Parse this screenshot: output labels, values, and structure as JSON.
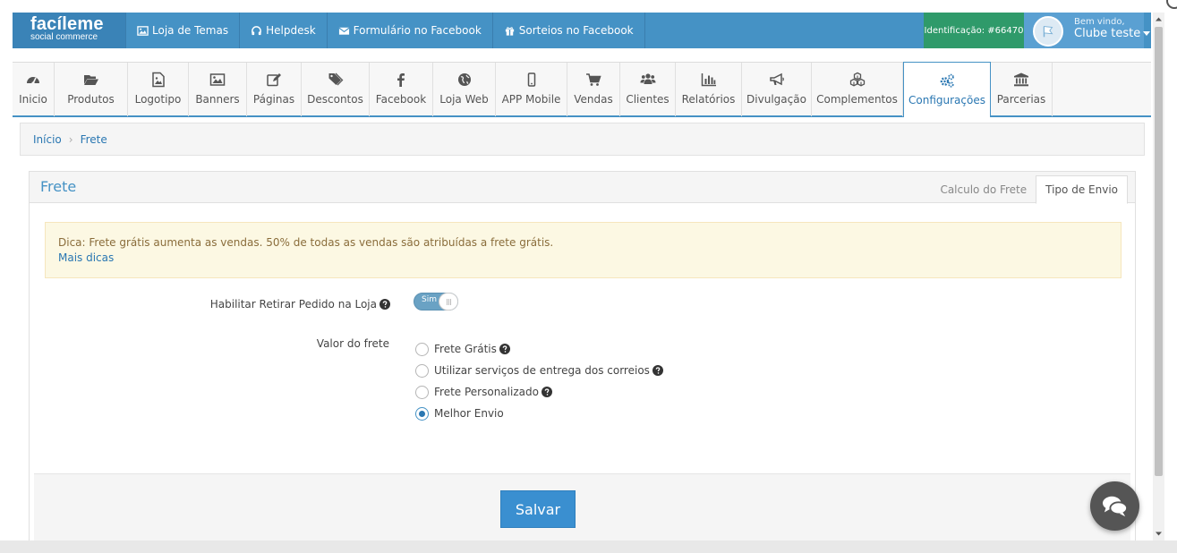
{
  "brand": {
    "name": "facíleme",
    "tagline": "social commerce"
  },
  "toplinks": [
    {
      "label": "Loja de Temas",
      "icon": "image-icon"
    },
    {
      "label": "Helpdesk",
      "icon": "headphones-icon"
    },
    {
      "label": "Formulário no Facebook",
      "icon": "envelope-icon"
    },
    {
      "label": "Sorteios no Facebook",
      "icon": "gift-icon"
    }
  ],
  "identification": "Identificação: #66470",
  "user": {
    "welcome": "Bem vindo,",
    "name": "Clube teste"
  },
  "nav": [
    {
      "label": "Inicio",
      "icon": "dashboard-icon"
    },
    {
      "label": "Produtos",
      "icon": "folder-open-icon"
    },
    {
      "label": "Logotipo",
      "icon": "file-image-icon"
    },
    {
      "label": "Banners",
      "icon": "picture-icon"
    },
    {
      "label": "Páginas",
      "icon": "edit-icon"
    },
    {
      "label": "Descontos",
      "icon": "tags-icon"
    },
    {
      "label": "Facebook",
      "icon": "facebook-icon"
    },
    {
      "label": "Loja Web",
      "icon": "globe-icon"
    },
    {
      "label": "APP Mobile",
      "icon": "mobile-icon"
    },
    {
      "label": "Vendas",
      "icon": "cart-icon"
    },
    {
      "label": "Clientes",
      "icon": "users-icon"
    },
    {
      "label": "Relatórios",
      "icon": "bar-chart-icon"
    },
    {
      "label": "Divulgação",
      "icon": "bullhorn-icon"
    },
    {
      "label": "Complementos",
      "icon": "cubes-icon"
    },
    {
      "label": "Configurações",
      "icon": "cogs-icon",
      "active": true
    },
    {
      "label": "Parcerias",
      "icon": "bank-icon"
    }
  ],
  "breadcrumb": {
    "home": "Início",
    "current": "Frete"
  },
  "panel": {
    "title": "Frete",
    "tabs": [
      {
        "label": "Calculo do Frete",
        "active": false
      },
      {
        "label": "Tipo de Envio",
        "active": true
      }
    ]
  },
  "alert": {
    "text": "Dica: Frete grátis aumenta as vendas. 50% de todas as vendas são atribuídas a frete grátis.",
    "link": "Mais dicas"
  },
  "form": {
    "pickup_label": "Habilitar Retirar Pedido na Loja",
    "pickup_toggle": "Sim",
    "shipping_label": "Valor do frete",
    "options": [
      {
        "label": "Frete Grátis",
        "help": true,
        "checked": false
      },
      {
        "label": "Utilizar serviços de entrega dos correios",
        "help": true,
        "checked": false
      },
      {
        "label": "Frete Personalizado",
        "help": true,
        "checked": false
      },
      {
        "label": "Melhor Envio",
        "help": false,
        "checked": true
      }
    ],
    "save_label": "Salvar"
  },
  "colors": {
    "primary": "#4592c5",
    "active_text": "#2a77b2",
    "ident_bg": "#2f9a6a",
    "alert_bg": "#fcf8e3"
  }
}
